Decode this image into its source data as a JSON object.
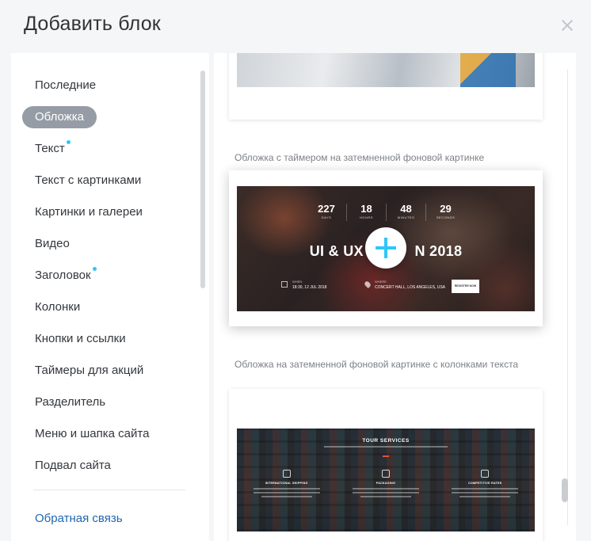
{
  "dialog": {
    "title": "Добавить блок"
  },
  "sidebar": {
    "items": [
      {
        "label": "Последние",
        "active": false,
        "dot": false
      },
      {
        "label": "Обложка",
        "active": true,
        "dot": false
      },
      {
        "label": "Текст",
        "active": false,
        "dot": true
      },
      {
        "label": "Текст с картинками",
        "active": false,
        "dot": false
      },
      {
        "label": "Картинки и галереи",
        "active": false,
        "dot": false
      },
      {
        "label": "Видео",
        "active": false,
        "dot": false
      },
      {
        "label": "Заголовок",
        "active": false,
        "dot": true
      },
      {
        "label": "Колонки",
        "active": false,
        "dot": false
      },
      {
        "label": "Кнопки и ссылки",
        "active": false,
        "dot": false
      },
      {
        "label": "Таймеры для акций",
        "active": false,
        "dot": false
      },
      {
        "label": "Разделитель",
        "active": false,
        "dot": false
      },
      {
        "label": "Меню и шапка сайта",
        "active": false,
        "dot": false
      },
      {
        "label": "Подвал сайта",
        "active": false,
        "dot": false
      }
    ],
    "feedback_link": "Обратная связь"
  },
  "blocks": {
    "timer_block": {
      "label": "Обложка с таймером на затемненной фоновой картинке",
      "countdown": [
        {
          "value": "227",
          "caption": "DAYS"
        },
        {
          "value": "18",
          "caption": "HOURS"
        },
        {
          "value": "48",
          "caption": "MINUTES"
        },
        {
          "value": "29",
          "caption": "SECONDS"
        }
      ],
      "hero_title_left": "UI & UX D",
      "hero_title_right": "N 2018",
      "when_caption": "WHEN",
      "when_value": "18:30, 12 JUL 2018",
      "where_caption": "WHERE",
      "where_value": "CONCERT HALL, LOS ANGELES, USA",
      "register_label": "REGISTER NOW"
    },
    "columns_block": {
      "label": "Обложка на затемненной фоновой картинке с колонками текста",
      "title": "TOUR SERVICES",
      "columns": [
        {
          "name": "INTERNATIONAL SHIPPING"
        },
        {
          "name": "PACKAGING"
        },
        {
          "name": "COMPETITIVE RATES"
        }
      ]
    }
  },
  "colors": {
    "accent": "#2fc6f6",
    "active_pill": "#969ca5",
    "link": "#2067b0"
  }
}
